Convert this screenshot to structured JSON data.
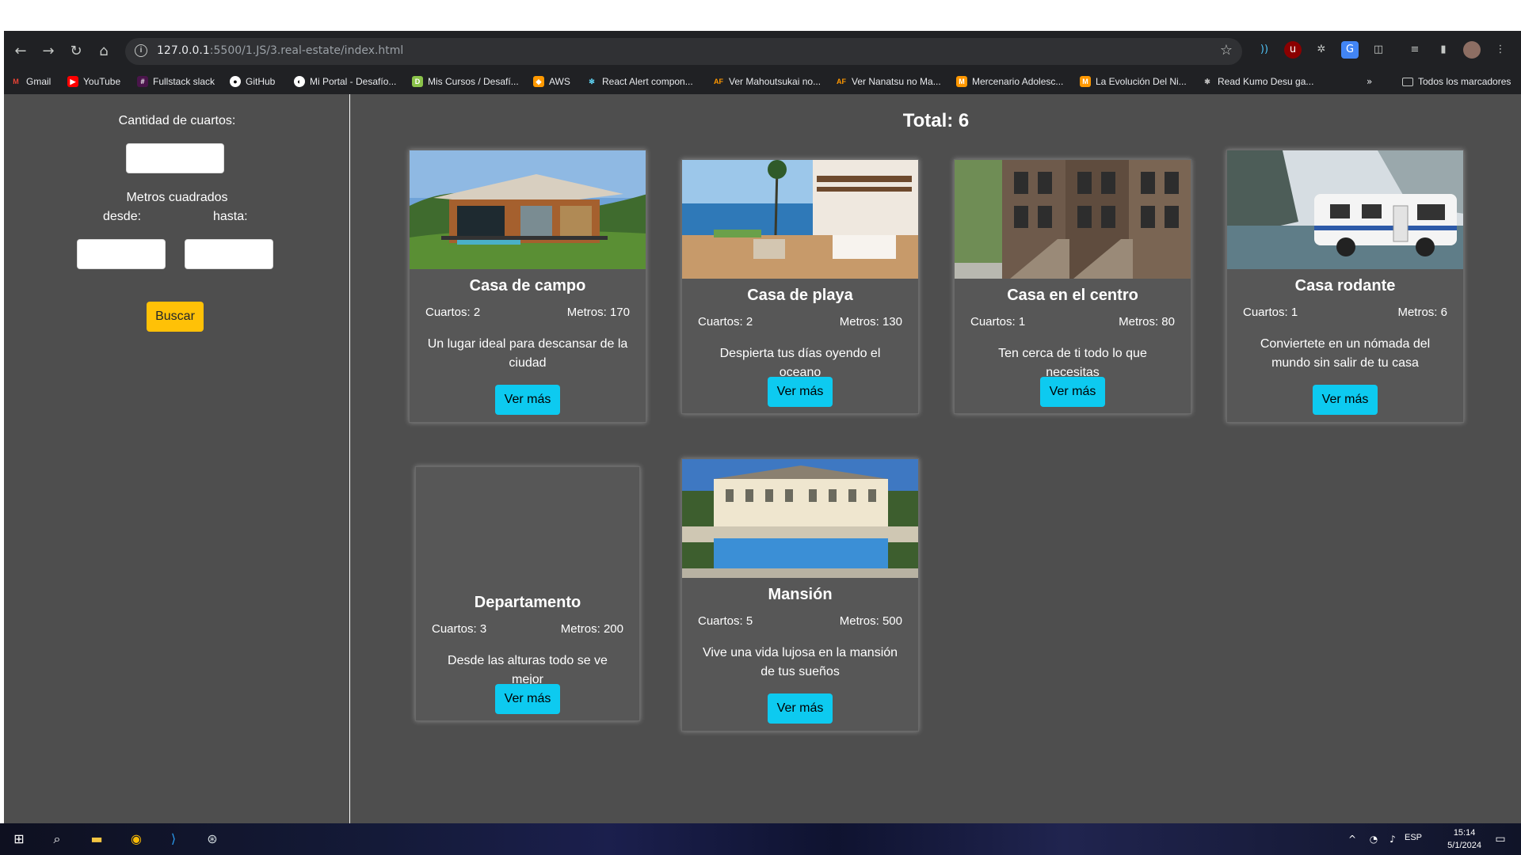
{
  "browser": {
    "url_host": "127.0.0.1",
    "url_rest": ":5500/1.JS/3.real-estate/index.html",
    "bookmarks": [
      {
        "label": "Gmail",
        "icon": "gmail-icon",
        "color": "#ea4335"
      },
      {
        "label": "YouTube",
        "icon": "youtube-icon",
        "color": "#ff0000"
      },
      {
        "label": "Fullstack slack",
        "icon": "slack-icon",
        "color": "#4a154b"
      },
      {
        "label": "GitHub",
        "icon": "github-icon",
        "color": "#ffffff"
      },
      {
        "label": "Mi Portal - Desafío...",
        "icon": "portal-icon",
        "color": "#ffffff"
      },
      {
        "label": "Mis Cursos / Desafí...",
        "icon": "courses-icon",
        "color": "#8bc34a"
      },
      {
        "label": "AWS",
        "icon": "aws-icon",
        "color": "#ff9900"
      },
      {
        "label": "React Alert compon...",
        "icon": "react-icon",
        "color": "#61dafb"
      },
      {
        "label": "Ver Mahoutsukai no...",
        "icon": "af-icon",
        "color": "#ff5722"
      },
      {
        "label": "Ver Nanatsu no Ma...",
        "icon": "af-icon",
        "color": "#ff5722"
      },
      {
        "label": "Mercenario Adolesc...",
        "icon": "manga-icon",
        "color": "#ff9800"
      },
      {
        "label": "La Evolución Del Ni...",
        "icon": "manga-icon",
        "color": "#ff9800"
      },
      {
        "label": "Read Kumo Desu ga...",
        "icon": "spider-icon",
        "color": "#9e9e9e"
      }
    ],
    "all_bookmarks": "Todos los marcadores"
  },
  "sidebar": {
    "rooms_label": "Cantidad de cuartos:",
    "meters_label": "Metros cuadrados",
    "from_label": "desde:",
    "to_label": "hasta:",
    "search_button": "Buscar"
  },
  "total_label": "Total: 6",
  "properties": [
    {
      "name": "Casa de campo",
      "rooms": "Cuartos: 2",
      "meters": "Metros: 170",
      "description": "Un lugar ideal para descansar de la ciudad",
      "button": "Ver más",
      "image": "country-house"
    },
    {
      "name": "Casa de playa",
      "rooms": "Cuartos: 2",
      "meters": "Metros: 130",
      "description": "Despierta tus días oyendo el oceano",
      "button": "Ver más",
      "image": "beach-house"
    },
    {
      "name": "Casa en el centro",
      "rooms": "Cuartos: 1",
      "meters": "Metros: 80",
      "description": "Ten cerca de ti todo lo que necesitas",
      "button": "Ver más",
      "image": "downtown-house"
    },
    {
      "name": "Casa rodante",
      "rooms": "Cuartos: 1",
      "meters": "Metros: 6",
      "description": "Conviertete en un nómada del mundo sin salir de tu casa",
      "button": "Ver más",
      "image": "motorhome"
    },
    {
      "name": "Departamento",
      "rooms": "Cuartos: 3",
      "meters": "Metros: 200",
      "description": "Desde las alturas todo se ve mejor",
      "button": "Ver más",
      "image": "none"
    },
    {
      "name": "Mansión",
      "rooms": "Cuartos: 5",
      "meters": "Metros: 500",
      "description": "Vive una vida lujosa en la mansión de tus sueños",
      "button": "Ver más",
      "image": "mansion"
    }
  ],
  "taskbar": {
    "language": "ESP",
    "time": "15:14",
    "date": "5/1/2024"
  },
  "colors": {
    "page_bg": "#4e4e4e",
    "search_button": "#ffc107",
    "card_button": "#0dcaf0"
  }
}
